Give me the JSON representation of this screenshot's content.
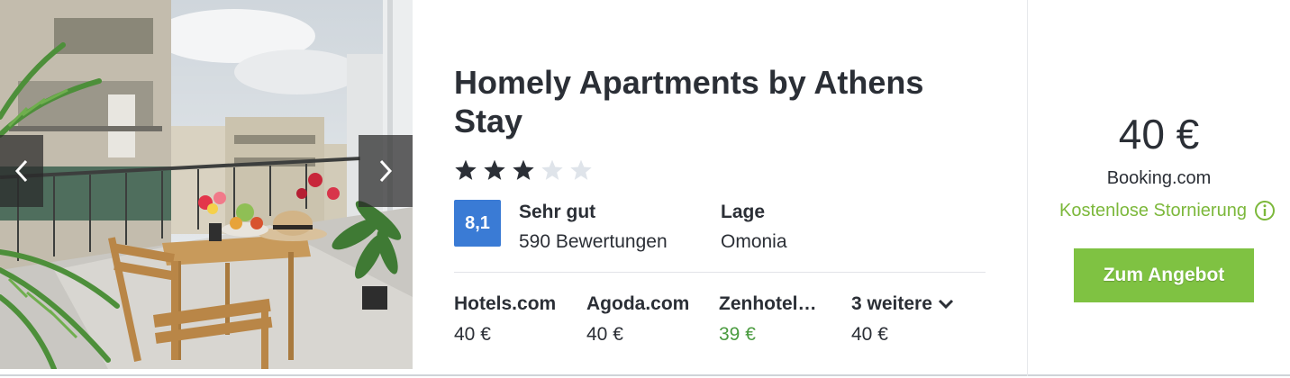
{
  "hotel": {
    "name": "Homely Apartments by Athens Stay",
    "stars_filled": 3,
    "stars_total": 5
  },
  "rating": {
    "score": "8,1",
    "label": "Sehr gut",
    "count": "590 Bewertungen",
    "score_color": "#3a7bd5"
  },
  "location": {
    "label": "Lage",
    "value": "Omonia"
  },
  "providers": [
    {
      "name": "Hotels.com",
      "price": "40 €"
    },
    {
      "name": "Agoda.com",
      "price": "40 €"
    },
    {
      "name": "Zenhotel…",
      "price": "39 €",
      "price_color": "#4a9b3f"
    },
    {
      "name": "3 weitere",
      "price": "40 €",
      "icon": "chevron-down-icon"
    }
  ],
  "deal": {
    "price": "40 €",
    "provider": "Booking.com",
    "cancellation": "Kostenlose Stornierung",
    "cancellation_icon": "info-icon",
    "button_label": "Zum Angebot",
    "button_color": "#7fc242"
  },
  "gallery": {
    "prev_icon": "chevron-left-icon",
    "next_icon": "chevron-right-icon"
  }
}
